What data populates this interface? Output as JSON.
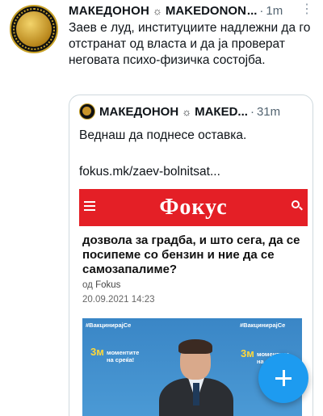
{
  "tweet": {
    "author": {
      "name": "МАКЕДОНОН",
      "separator_symbol": "☼",
      "name_latin": "MAKEDONON",
      "ellipsis": "...",
      "time": "1m",
      "more_icon": "more-vertical-icon"
    },
    "text": "Заев е луд, институциите надлежни да го отстранат од власта и да ја проверат неговата психо-физичка состојба."
  },
  "quote": {
    "author": {
      "name": "МАКЕДОНОН",
      "separator_symbol": "☼",
      "name_latin": "МАКЕD...",
      "time": "31m"
    },
    "text": "Веднаш да поднесе оставка.",
    "link": "fokus.mk/zaev-bolnitsat...",
    "article": {
      "logo": "Фокус",
      "headline": "дозвола за градба, и што сега, да се посипеме со бензин и ние да се самозапалиме?",
      "by_prefix": "од",
      "source": "Fokus",
      "date": "20.09.2021 14:23",
      "photo_tags": [
        "#ВакцинирајСе",
        "3м",
        "моментите на среќа!",
        "#ВакцинирајСе",
        "3м",
        "моментите на среќа!"
      ]
    }
  },
  "fab": {
    "icon": "plus-icon"
  },
  "colors": {
    "accent": "#1d9bf0",
    "fokus_red": "#e41f26",
    "muted": "#536471"
  }
}
